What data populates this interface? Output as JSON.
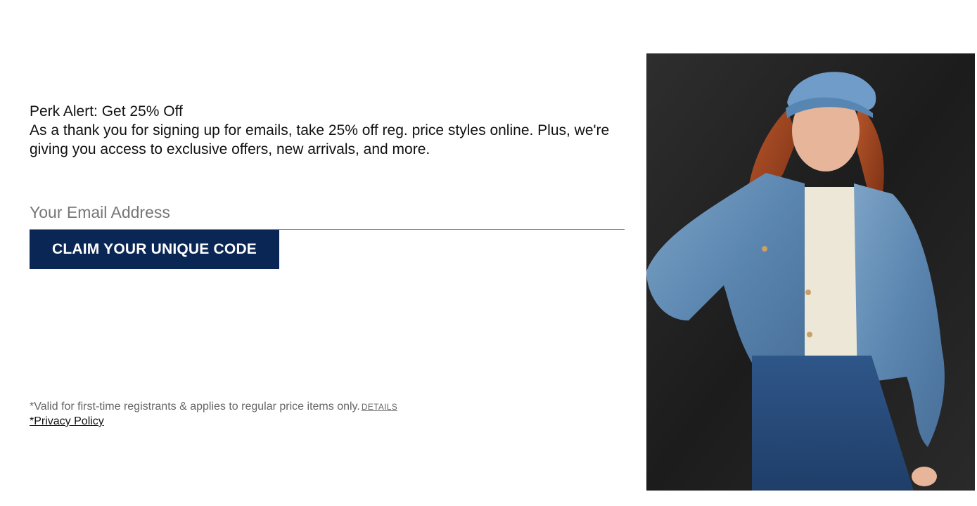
{
  "signup": {
    "headline": "Perk Alert: Get 25% Off",
    "body": "As a thank you for signing up for emails, take 25% off reg. price styles online. Plus, we're giving you access to exclusive offers, new arrivals, and more.",
    "email_placeholder": "Your Email Address",
    "email_value": "",
    "cta_label": "CLAIM YOUR UNIQUE CODE"
  },
  "legal": {
    "disclaimer": "*Valid for first-time registrants & applies to regular price items only.",
    "details_label": "DETAILS",
    "privacy_label": "*Privacy Policy"
  },
  "colors": {
    "cta_background": "#0a2655",
    "cta_text": "#ffffff",
    "body_text": "#111111",
    "muted_text": "#666666"
  }
}
